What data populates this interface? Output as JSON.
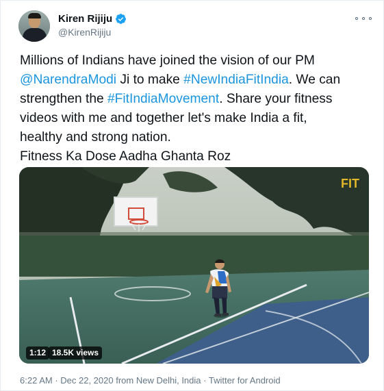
{
  "user": {
    "display_name": "Kiren Rijiju",
    "handle": "@KirenRijiju",
    "verified": true,
    "avatar_icon": "profile-photo"
  },
  "tweet": {
    "lines": [
      [
        {
          "text": "Millions of Indians have joined the vision of our PM",
          "link": false
        }
      ],
      [
        {
          "text": "@NarendraModi",
          "link": true
        },
        {
          "text": " Ji to make ",
          "link": false
        },
        {
          "text": "#NewIndiaFitIndia",
          "link": true
        },
        {
          "text": ". We can",
          "link": false
        }
      ],
      [
        {
          "text": "strengthen the ",
          "link": false
        },
        {
          "text": "#FitIndiaMovement",
          "link": true
        },
        {
          "text": ". Share your fitness",
          "link": false
        }
      ],
      [
        {
          "text": "videos with me and together let's make India a fit,",
          "link": false
        }
      ],
      [
        {
          "text": "healthy and strong nation.",
          "link": false
        }
      ],
      [
        {
          "text": "Fitness Ka Dose Aadha Ghanta Roz",
          "link": false
        }
      ]
    ],
    "link_color": "#1b95e0"
  },
  "video": {
    "duration": "1:12",
    "views": "18.5K views",
    "watermark": "FIT"
  },
  "meta": {
    "time": "6:22 AM",
    "date": "Dec 22, 2020",
    "location": "from New Delhi, India",
    "source": "Twitter for Android",
    "separator": " · "
  },
  "icons": {
    "verified": "verified-badge-icon",
    "more": "more-options-icon"
  }
}
